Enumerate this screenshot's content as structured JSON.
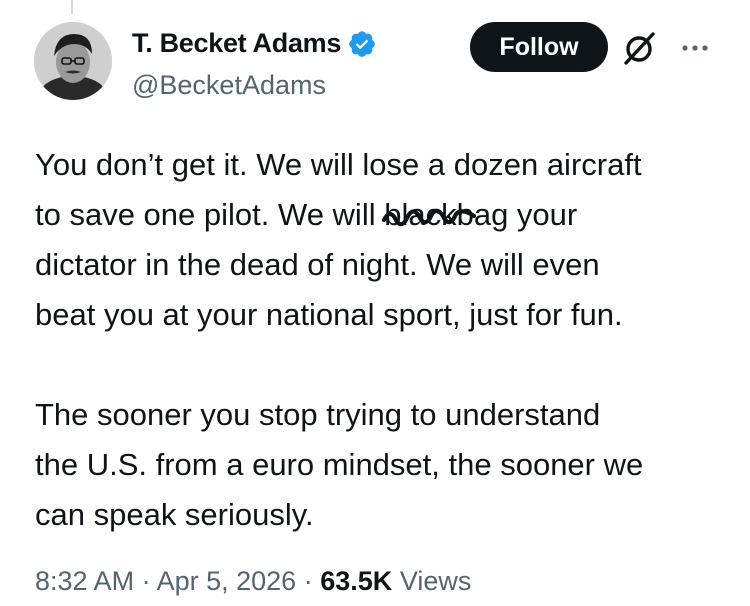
{
  "author": {
    "display_name": "T. Becket Adams",
    "handle": "@BecketAdams",
    "verified": true
  },
  "follow_button": {
    "label": "Follow"
  },
  "tweet": {
    "lines": [
      "You don’t get it. We will lose a dozen aircraft",
      "to save one pilot. We will ",
      "dictator in the dead of night. We will even",
      "beat you at your national sport, just for fun.",
      "The sooner you stop trying to understand",
      "the U.S. from a euro mindset, the sooner we",
      "can speak seriously."
    ],
    "struck_word": "blackbag",
    "struck_display_fragment": "black",
    "after_struck": "bag your"
  },
  "meta": {
    "time": "8:32 AM",
    "separator": "·",
    "date": "Apr 5, 2026",
    "views_count": "63.5K",
    "views_label": "Views"
  },
  "icons": {
    "verified": "verified-badge-icon",
    "grok": "grok-icon",
    "more": "more-dots-icon"
  },
  "colors": {
    "text": "#0f1419",
    "secondary": "#536471",
    "verified_blue": "#1d9bf0",
    "button_bg": "#0f1419"
  }
}
